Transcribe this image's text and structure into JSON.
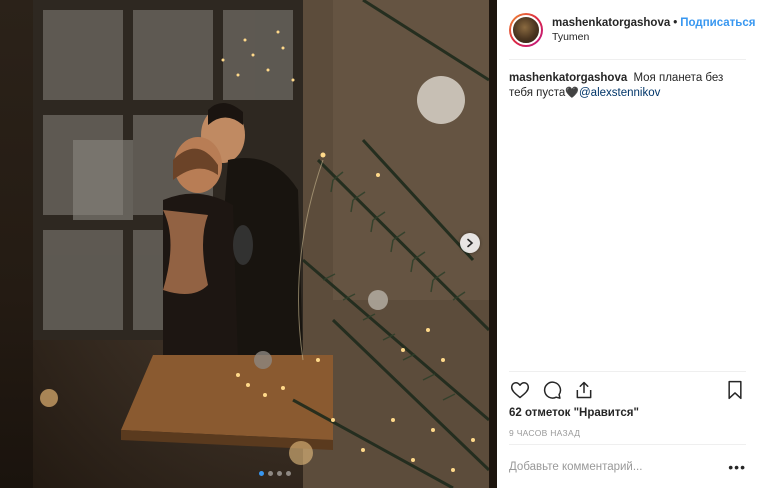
{
  "post": {
    "username": "mashenkatorgashova",
    "separator": "•",
    "follow_label": "Подписаться",
    "location": "Tyumen",
    "caption_text": "Моя планета без тебя пуста",
    "caption_emoji": "🖤",
    "mention": "@alexstennikov",
    "likes": "62 отметок \"Нравится\"",
    "time_ago": "9 ЧАСОВ НАЗАД",
    "comment_placeholder": "Добавьте комментарий...",
    "more_label": "•••"
  },
  "carousel": {
    "slides": 4,
    "active_index": 0
  },
  "icons": {
    "like": "heart-icon",
    "comment": "comment-icon",
    "share": "share-icon",
    "save": "bookmark-icon",
    "next": "chevron-right-icon"
  },
  "colors": {
    "link": "#3897f0",
    "mention": "#003569",
    "muted": "#999999",
    "text": "#262626"
  }
}
